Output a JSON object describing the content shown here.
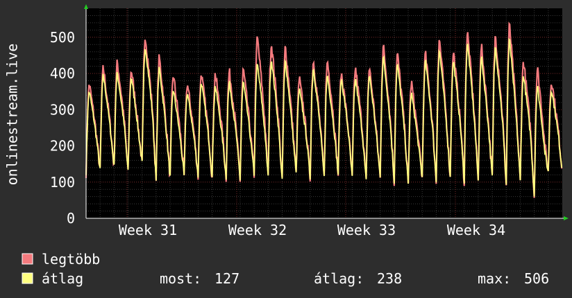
{
  "chart_data": {
    "type": "line",
    "ylabel": "onlinestream.live",
    "ylim": [
      0,
      580
    ],
    "y_ticks": [
      0,
      100,
      200,
      300,
      400,
      500
    ],
    "x_ticks": [
      "Week 31",
      "Week 32",
      "Week 33",
      "Week 34"
    ],
    "grid": true,
    "series": [
      {
        "name": "legtöbb",
        "color": "#f47a7e"
      },
      {
        "name": "átlag",
        "color": "#ffff80"
      }
    ],
    "daily_peaks_max": [
      375,
      420,
      435,
      415,
      510,
      450,
      400,
      375,
      405,
      405,
      410,
      415,
      505,
      490,
      480,
      390,
      440,
      440,
      405,
      420,
      420,
      480,
      460,
      380,
      460,
      500,
      465,
      520,
      480,
      510,
      540,
      440,
      420,
      385
    ],
    "daily_peaks_avg": [
      355,
      400,
      405,
      395,
      480,
      420,
      360,
      350,
      380,
      370,
      380,
      380,
      430,
      445,
      440,
      360,
      420,
      400,
      390,
      390,
      400,
      450,
      430,
      350,
      440,
      470,
      440,
      490,
      450,
      480,
      500,
      400,
      370,
      360
    ],
    "daily_troughs": [
      125,
      130,
      140,
      125,
      150,
      100,
      110,
      115,
      115,
      110,
      110,
      105,
      120,
      110,
      100,
      120,
      110,
      110,
      120,
      110,
      100,
      110,
      100,
      90,
      110,
      100,
      110,
      100,
      100,
      110,
      90,
      100,
      60,
      125
    ],
    "legend": {
      "max_label": "legtöbb",
      "avg_label": "átlag",
      "stats": [
        {
          "label": "most:",
          "value": "127"
        },
        {
          "label": "átlag:",
          "value": "238"
        },
        {
          "label": "max:",
          "value": "506"
        }
      ]
    }
  }
}
